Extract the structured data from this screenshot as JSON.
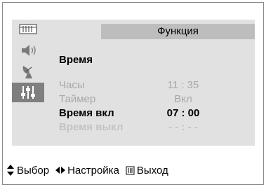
{
  "header": {
    "title": "Функция"
  },
  "sidebar": {
    "items": [
      {
        "icon": "picture-menu-icon"
      },
      {
        "icon": "speaker-icon"
      },
      {
        "icon": "antenna-icon"
      },
      {
        "icon": "function-settings-icon",
        "active": true
      }
    ]
  },
  "section": {
    "title": "Время"
  },
  "rows": [
    {
      "label": "Часы",
      "value": "11 : 35"
    },
    {
      "label": "Таймер",
      "value": "Вкл"
    },
    {
      "label": "Время вкл",
      "value": "07 : 00"
    },
    {
      "label": "Время выкл",
      "value": "- - : - -"
    }
  ],
  "footer": {
    "select_label": "Выбор",
    "adjust_label": "Настройка",
    "exit_label": "Выход"
  },
  "colors": {
    "panel": "#e1e1e1",
    "header_bar": "#bdbdbd",
    "active_sidebar": "#7f7f7f",
    "dim_text": "#a8a8a8"
  }
}
